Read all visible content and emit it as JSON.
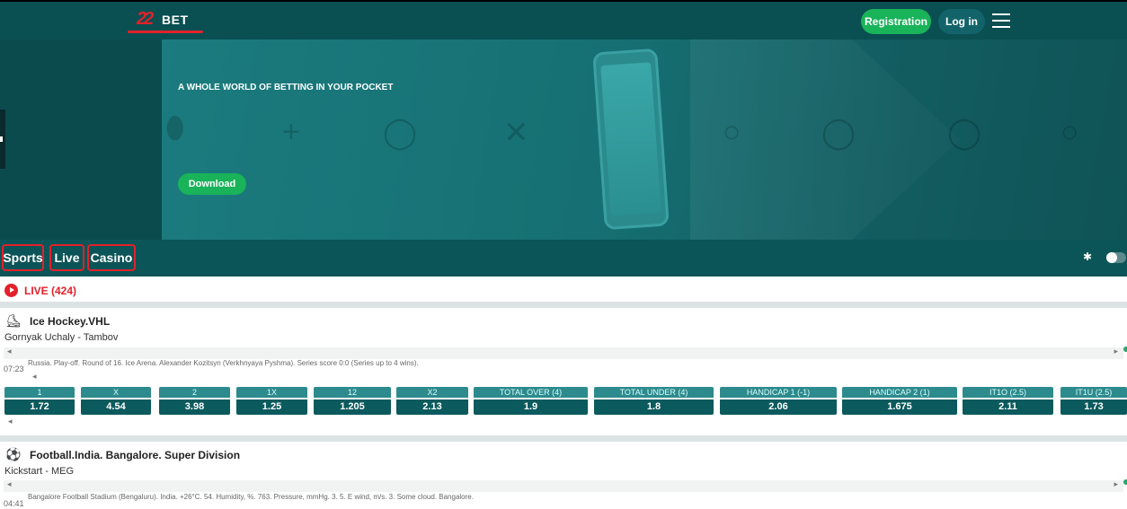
{
  "header": {
    "logo_number": "22",
    "logo_text": "BET",
    "registration_label": "Registration",
    "login_label": "Log in"
  },
  "banner": {
    "title": "A WHOLE WORLD OF BETTING IN YOUR POCKET",
    "download_label": "Download"
  },
  "nav": {
    "sports": "Sports",
    "live": "Live",
    "casino": "Casino"
  },
  "live_header": "LIVE (424)",
  "games": [
    {
      "league": "Ice Hockey.VHL",
      "teams": "Gornyak Uchaly - Tambov",
      "time": "07:23",
      "info": "Russia. Play-off. Round of 16. Ice Arena. Alexander Kozitsyn (Verkhnyaya Pyshma). Series score 0:0 (Series up to 4 wins).",
      "odds": [
        {
          "label": "1",
          "value": "1.72"
        },
        {
          "label": "X",
          "value": "4.54"
        },
        {
          "label": "2",
          "value": "3.98"
        },
        {
          "label": "1X",
          "value": "1.25"
        },
        {
          "label": "12",
          "value": "1.205"
        },
        {
          "label": "X2",
          "value": "2.13"
        },
        {
          "label": "TOTAL OVER (4)",
          "value": "1.9"
        },
        {
          "label": "TOTAL UNDER (4)",
          "value": "1.8"
        },
        {
          "label": "HANDICAP 1 (-1)",
          "value": "2.06"
        },
        {
          "label": "HANDICAP 2 (1)",
          "value": "1.675"
        },
        {
          "label": "IT1O (2.5)",
          "value": "2.11"
        },
        {
          "label": "IT1U (2.5)",
          "value": "1.73"
        }
      ]
    },
    {
      "league": "Football.India. Bangalore. Super Division",
      "teams": "Kickstart - MEG",
      "time": "04:41",
      "info": "Bangalore Football Stadium (Bengaluru). India. +26°C. 54. Humidity, %. 763. Pressure, mmHg. 3. 5. E wind, m/s. 3. Some cloud. Bangalore."
    }
  ],
  "colors": {
    "header_bg": "#0a4f52",
    "accent_green": "#19b35a",
    "live_red": "#e4202a",
    "odds_dark": "#0b5a5d"
  }
}
